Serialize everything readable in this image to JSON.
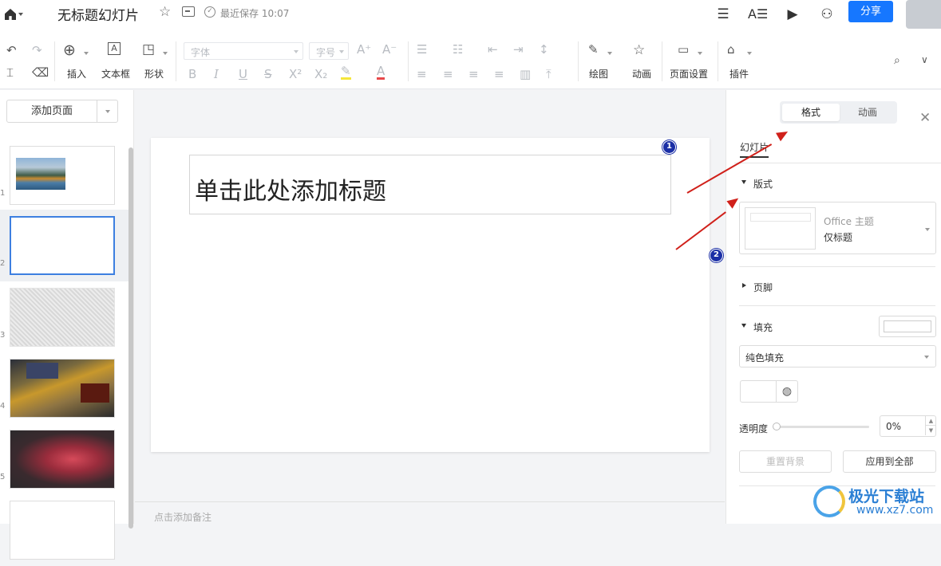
{
  "header": {
    "doc_title": "无标题幻灯片",
    "saved_status": "最近保存 10:07",
    "share_label": "分享"
  },
  "toolbar": {
    "insert_label": "插入",
    "textbox_label": "文本框",
    "shape_label": "形状",
    "font_placeholder": "字体",
    "size_placeholder": "字号",
    "draw_label": "绘图",
    "animation_label": "动画",
    "page_setup_label": "页面设置",
    "plugin_label": "插件"
  },
  "left_panel": {
    "add_page_label": "添加页面",
    "slides": [
      {
        "num": "1"
      },
      {
        "num": "2"
      },
      {
        "num": "3"
      },
      {
        "num": "4"
      },
      {
        "num": "5"
      }
    ]
  },
  "slide": {
    "title_placeholder": "单击此处添加标题",
    "notes_placeholder": "点击添加备注"
  },
  "right_panel": {
    "tabs": [
      "格式",
      "动画"
    ],
    "section_tab": "幻灯片",
    "layout_label": "版式",
    "layout_theme": "Office 主题",
    "layout_name": "仅标题",
    "footer_label": "页脚",
    "fill_label": "填充",
    "fill_type": "纯色填充",
    "opacity_label": "透明度",
    "opacity_value": "0%",
    "opacity": 0,
    "reset_bg_label": "重置背景",
    "apply_all_label": "应用到全部"
  },
  "annotations": {
    "badge_1": "1",
    "badge_2": "2"
  },
  "watermark": {
    "title": "极光下载站",
    "url": "www.xz7.com"
  },
  "colors": {
    "accent": "#1677ff",
    "arrow": "#d0201a",
    "badge": "#1b2fa6"
  }
}
